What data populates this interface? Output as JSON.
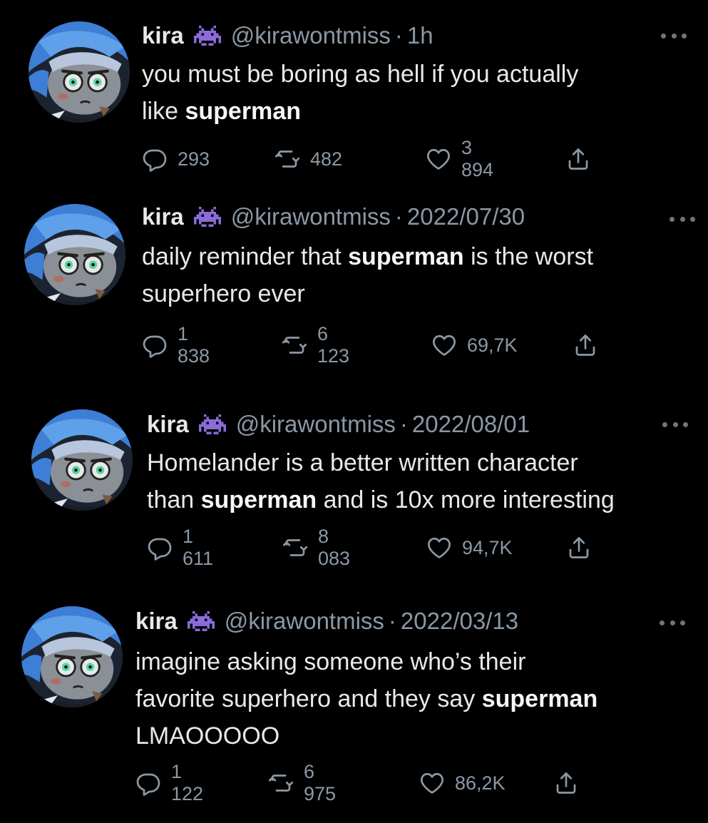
{
  "colors": {
    "background": "#000000",
    "primary_text": "#e7e9ea",
    "secondary_text": "#8b98a5",
    "alien_icon": "#8a6bd9"
  },
  "tweets": [
    {
      "name": "kira",
      "handle": "@kirawontmiss",
      "separator": "·",
      "time": "1h",
      "text_lines": [
        [
          {
            "t": "you must be boring as hell if you actually",
            "b": false
          }
        ],
        [
          {
            "t": "like ",
            "b": false
          },
          {
            "t": "superman",
            "b": true
          }
        ]
      ],
      "replies": "293",
      "retweets": "482",
      "likes": "3 894"
    },
    {
      "name": "kira",
      "handle": "@kirawontmiss",
      "separator": "·",
      "time": "2022/07/30",
      "text_lines": [
        [
          {
            "t": "daily reminder that ",
            "b": false
          },
          {
            "t": "superman",
            "b": true
          },
          {
            "t": " is the worst",
            "b": false
          }
        ],
        [
          {
            "t": "superhero ever",
            "b": false
          }
        ]
      ],
      "replies": "1 838",
      "retweets": "6 123",
      "likes": "69,7K"
    },
    {
      "name": "kira",
      "handle": "@kirawontmiss",
      "separator": "·",
      "time": "2022/08/01",
      "text_lines": [
        [
          {
            "t": "Homelander is a better written character",
            "b": false
          }
        ],
        [
          {
            "t": "than ",
            "b": false
          },
          {
            "t": "superman",
            "b": true
          },
          {
            "t": " and is 10x more interesting",
            "b": false
          }
        ]
      ],
      "replies": "1 611",
      "retweets": "8 083",
      "likes": "94,7K"
    },
    {
      "name": "kira",
      "handle": "@kirawontmiss",
      "separator": "·",
      "time": "2022/03/13",
      "text_lines": [
        [
          {
            "t": "imagine asking someone who’s their",
            "b": false
          }
        ],
        [
          {
            "t": "favorite superhero and they say ",
            "b": false
          },
          {
            "t": "superman",
            "b": true
          }
        ],
        [
          {
            "t": "LMAOOOOO",
            "b": false
          }
        ]
      ],
      "replies": "1 122",
      "retweets": "6 975",
      "likes": "86,2K"
    }
  ]
}
